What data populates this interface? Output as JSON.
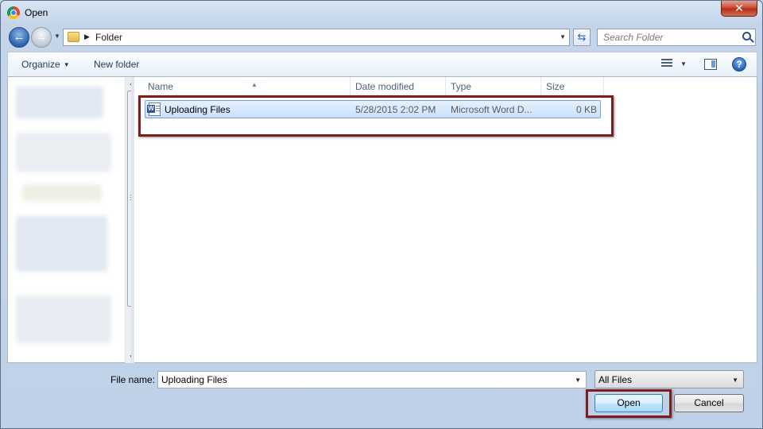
{
  "window": {
    "title": "Open",
    "close_label": "✕"
  },
  "address_bar": {
    "path": "Folder"
  },
  "search": {
    "placeholder": "Search Folder"
  },
  "toolbar": {
    "organize_label": "Organize",
    "new_folder_label": "New folder",
    "help_label": "?"
  },
  "columns": {
    "name": "Name",
    "date_modified": "Date modified",
    "type": "Type",
    "size": "Size"
  },
  "files": [
    {
      "name": "Uploading Files",
      "date_modified": "5/28/2015 2:02 PM",
      "type": "Microsoft Word D...",
      "size": "0 KB",
      "icon": "word-document-icon",
      "selected": true
    }
  ],
  "bottom": {
    "file_name_label": "File name:",
    "file_name_value": "Uploading Files",
    "file_type_filter": "All Files",
    "open_button": "Open",
    "cancel_button": "Cancel"
  },
  "colors": {
    "highlight_border": "#7d1d1d",
    "selection_fill": "#c9e0fa",
    "open_button_fill": "#bee6fd"
  }
}
